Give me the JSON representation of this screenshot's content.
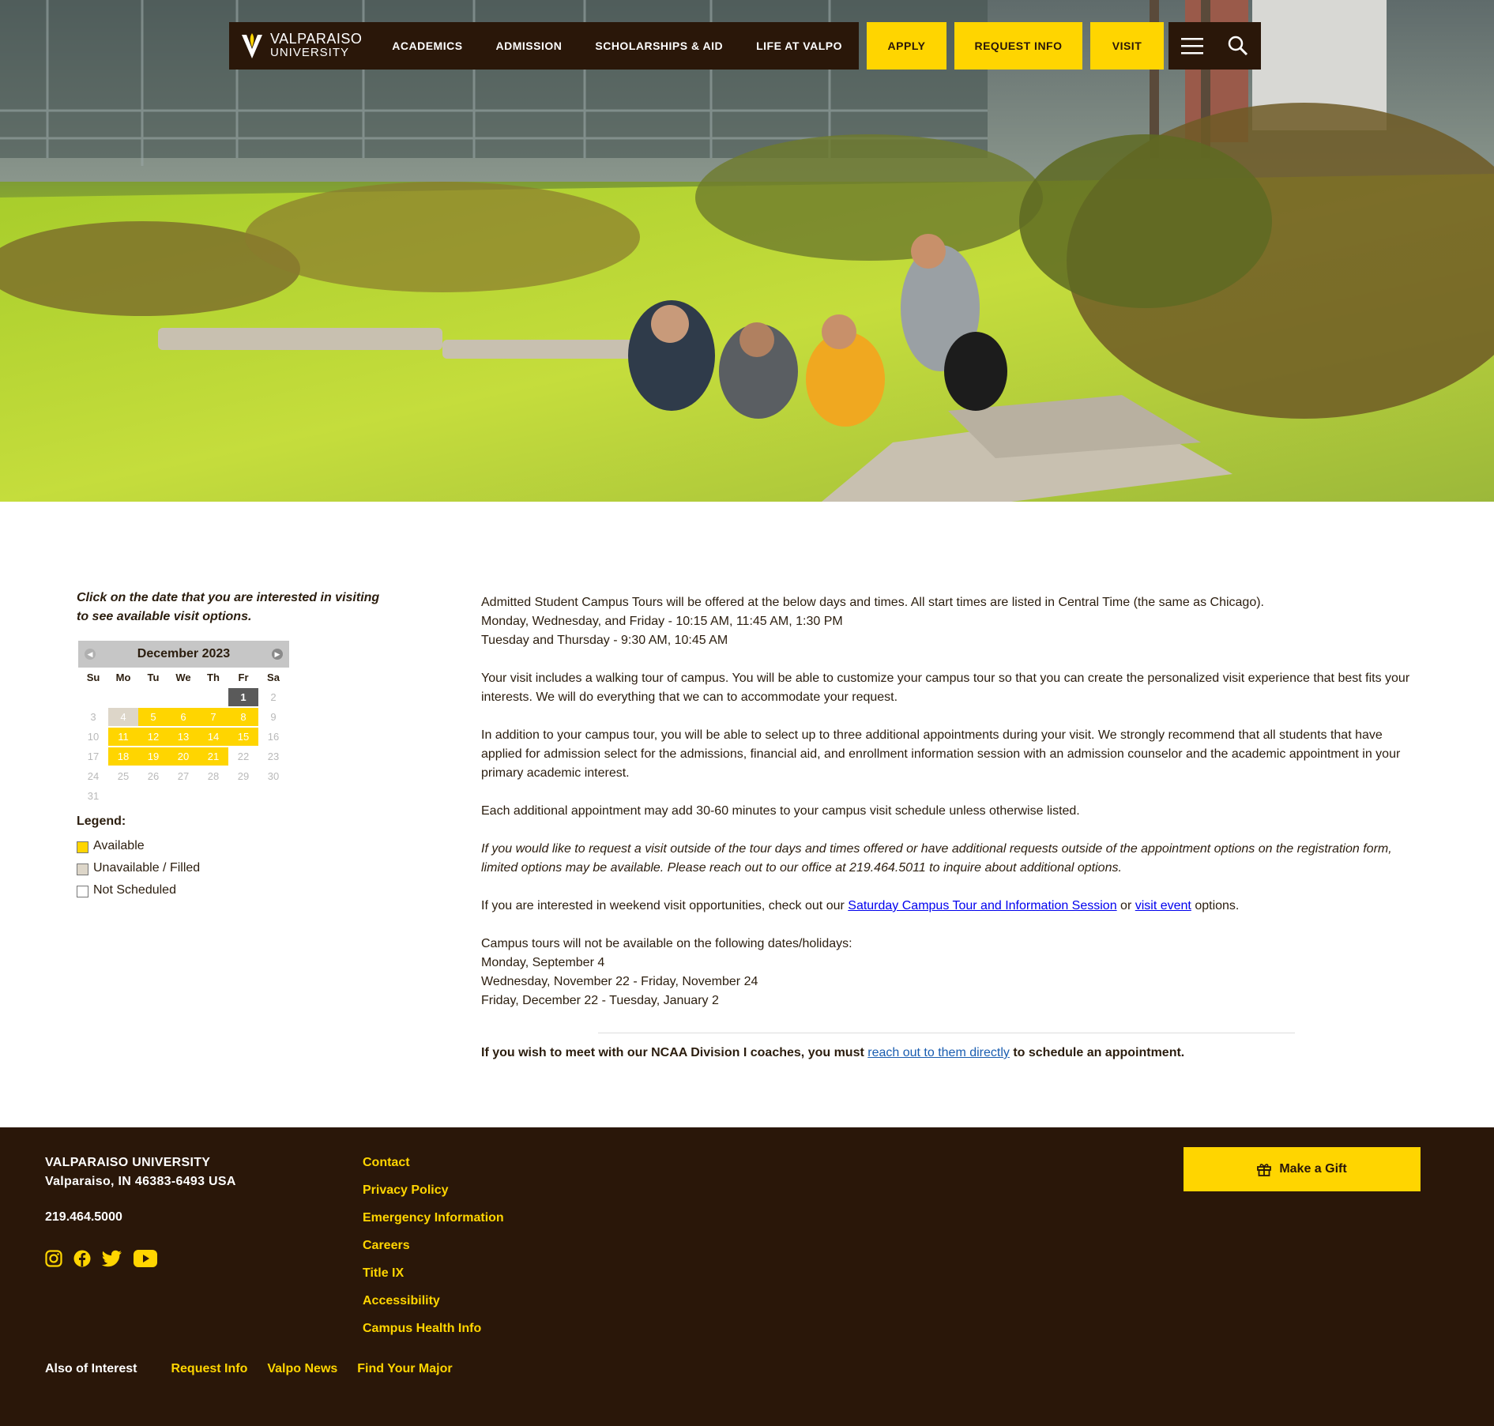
{
  "brand": {
    "line1": "VALPARAISO",
    "line2": "UNIVERSITY"
  },
  "nav": {
    "links": [
      "ACADEMICS",
      "ADMISSION",
      "SCHOLARSHIPS & AID",
      "LIFE AT VALPO"
    ],
    "ctas": [
      "APPLY",
      "REQUEST INFO",
      "VISIT"
    ],
    "icons": [
      "menu-icon",
      "search-icon"
    ]
  },
  "calendar": {
    "intro": "Click on the date that you are interested in visiting to see available visit options.",
    "month": "December 2023",
    "weekdays": [
      "Su",
      "Mo",
      "Tu",
      "We",
      "Th",
      "Fr",
      "Sa"
    ],
    "weeks": [
      [
        null,
        null,
        null,
        null,
        null,
        {
          "day": "1",
          "status": "today"
        },
        {
          "day": "2",
          "status": "none"
        }
      ],
      [
        {
          "day": "3",
          "status": "none"
        },
        {
          "day": "4",
          "status": "unavailable"
        },
        {
          "day": "5",
          "status": "available"
        },
        {
          "day": "6",
          "status": "available"
        },
        {
          "day": "7",
          "status": "available"
        },
        {
          "day": "8",
          "status": "available"
        },
        {
          "day": "9",
          "status": "none"
        }
      ],
      [
        {
          "day": "10",
          "status": "none"
        },
        {
          "day": "11",
          "status": "available"
        },
        {
          "day": "12",
          "status": "available"
        },
        {
          "day": "13",
          "status": "available"
        },
        {
          "day": "14",
          "status": "available"
        },
        {
          "day": "15",
          "status": "available"
        },
        {
          "day": "16",
          "status": "none"
        }
      ],
      [
        {
          "day": "17",
          "status": "none"
        },
        {
          "day": "18",
          "status": "available"
        },
        {
          "day": "19",
          "status": "available"
        },
        {
          "day": "20",
          "status": "available"
        },
        {
          "day": "21",
          "status": "available"
        },
        {
          "day": "22",
          "status": "none"
        },
        {
          "day": "23",
          "status": "none"
        }
      ],
      [
        {
          "day": "24",
          "status": "none"
        },
        {
          "day": "25",
          "status": "none"
        },
        {
          "day": "26",
          "status": "none"
        },
        {
          "day": "27",
          "status": "none"
        },
        {
          "day": "28",
          "status": "none"
        },
        {
          "day": "29",
          "status": "none"
        },
        {
          "day": "30",
          "status": "none"
        }
      ],
      [
        {
          "day": "31",
          "status": "none"
        },
        null,
        null,
        null,
        null,
        null,
        null
      ]
    ],
    "legend": {
      "title": "Legend:",
      "items": [
        {
          "label": "Available",
          "color": "#ffd500"
        },
        {
          "label": "Unavailable / Filled",
          "color": "#ddd6c9"
        },
        {
          "label": "Not Scheduled",
          "color": "#ffffff"
        }
      ]
    }
  },
  "content": {
    "p1_l1": "Admitted Student Campus Tours will be offered at the below days and times. All start times are listed in Central Time (the same as Chicago).",
    "p1_l2": "Monday, Wednesday, and Friday - 10:15 AM, 11:45 AM, 1:30 PM",
    "p1_l3": "Tuesday and Thursday - 9:30 AM, 10:45 AM",
    "p2": "Your visit includes a walking tour of campus. You will be able to customize your campus tour so that you can create the personalized visit experience that best fits your interests. We will do everything that we can to accommodate your request.",
    "p3": "In addition to your campus tour, you will be able to select up to three additional appointments during your visit. We strongly recommend that all students that have applied for admission select for the admissions, financial aid, and enrollment information session with an admission counselor and the academic appointment in your primary academic interest.",
    "p4": "Each additional appointment may add 30-60 minutes to your campus visit schedule unless otherwise listed.",
    "p5": "If you would like to request a visit outside of the tour days and times offered or have additional requests outside of the appointment options on the registration form, limited options may be available. Please reach out to our office at 219.464.5011 to inquire about additional options.",
    "p6_pre": "If you are interested in weekend visit opportunities, check out our ",
    "p6_link1": "Saturday Campus Tour and Information Session",
    "p6_mid": " or ",
    "p6_link2": "visit event",
    "p6_post": " options.",
    "p7_l1": "Campus tours will not be available on the following dates/holidays:",
    "p7_l2": "Monday, September 4",
    "p7_l3": "Wednesday, November 22 - Friday, November 24",
    "p7_l4": "Friday, December 22 - Tuesday, January 2",
    "coach_pre": "If you wish to meet with our NCAA Division I coaches, you must ",
    "coach_link": "reach out to them directly",
    "coach_post": " to schedule an appointment."
  },
  "footer": {
    "org": "VALPARAISO UNIVERSITY",
    "address": "Valparaiso, IN 46383-6493 USA",
    "phone": "219.464.5000",
    "social": [
      "instagram-icon",
      "facebook-icon",
      "twitter-icon",
      "youtube-icon"
    ],
    "links": [
      "Contact",
      "Privacy Policy",
      "Emergency Information",
      "Careers",
      "Title IX",
      "Accessibility",
      "Campus Health Info"
    ],
    "gift": "Make a Gift",
    "also_label": "Also of Interest",
    "also_links": [
      "Request Info",
      "Valpo News",
      "Find Your Major"
    ]
  },
  "colors": {
    "brown": "#2a1709",
    "gold": "#ffd500",
    "unavailable": "#ddd6c9"
  }
}
